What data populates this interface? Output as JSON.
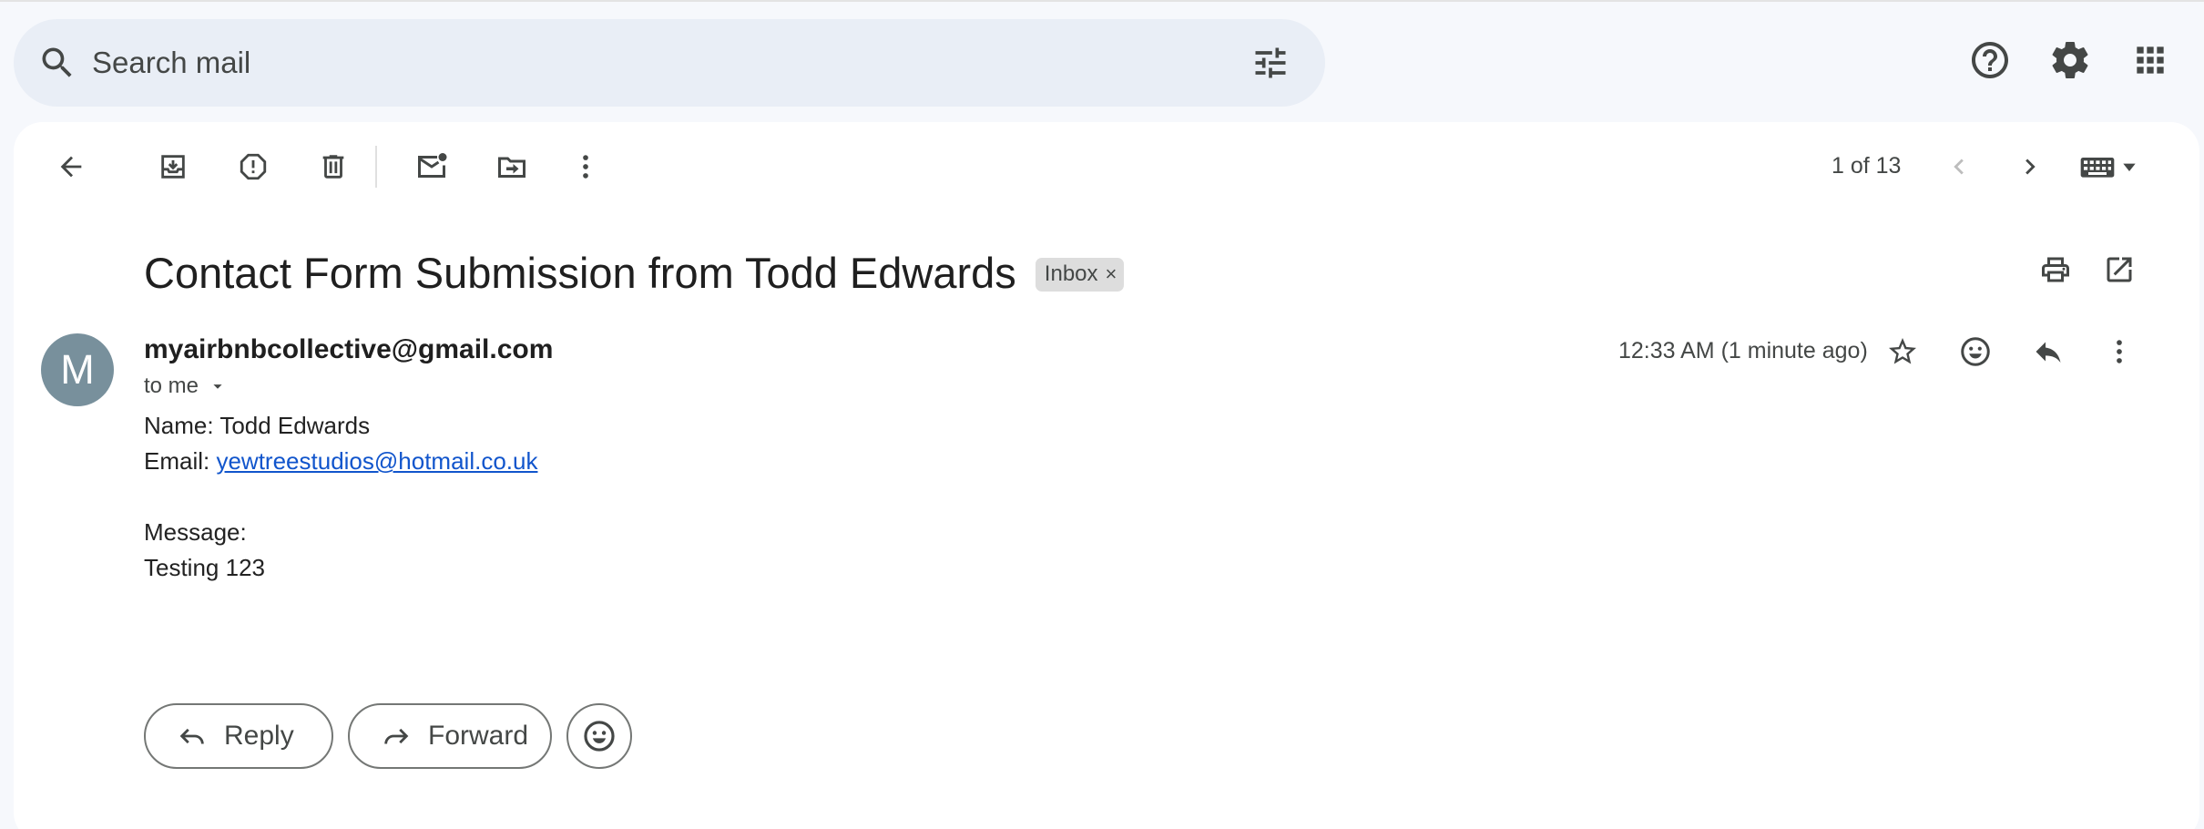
{
  "search": {
    "placeholder": "Search mail"
  },
  "toolbar": {
    "icons": [
      "back-arrow-icon",
      "archive-icon",
      "report-spam-icon",
      "delete-icon",
      "mark-unread-icon",
      "move-to-icon",
      "more-vert-icon"
    ],
    "pager_text": "1 of 13"
  },
  "email": {
    "subject": "Contact Form Submission from Todd Edwards",
    "label": "Inbox",
    "label_remove": "×",
    "avatar_letter": "M",
    "sender": "myairbnbcollective@gmail.com",
    "recipient": "to me",
    "timestamp": "12:33 AM (1 minute ago)",
    "body": {
      "name_line": "Name: Todd Edwards",
      "email_prefix": "Email: ",
      "email_link": "yewtreestudios@hotmail.co.uk",
      "message_label": "Message:",
      "message_text": "Testing 123"
    }
  },
  "actions": {
    "reply_label": "Reply",
    "forward_label": "Forward"
  },
  "colors": {
    "page_bg": "#f6f8fc",
    "search_bg": "#e9eef6",
    "avatar_bg": "#78909c",
    "link": "#1155cc"
  }
}
